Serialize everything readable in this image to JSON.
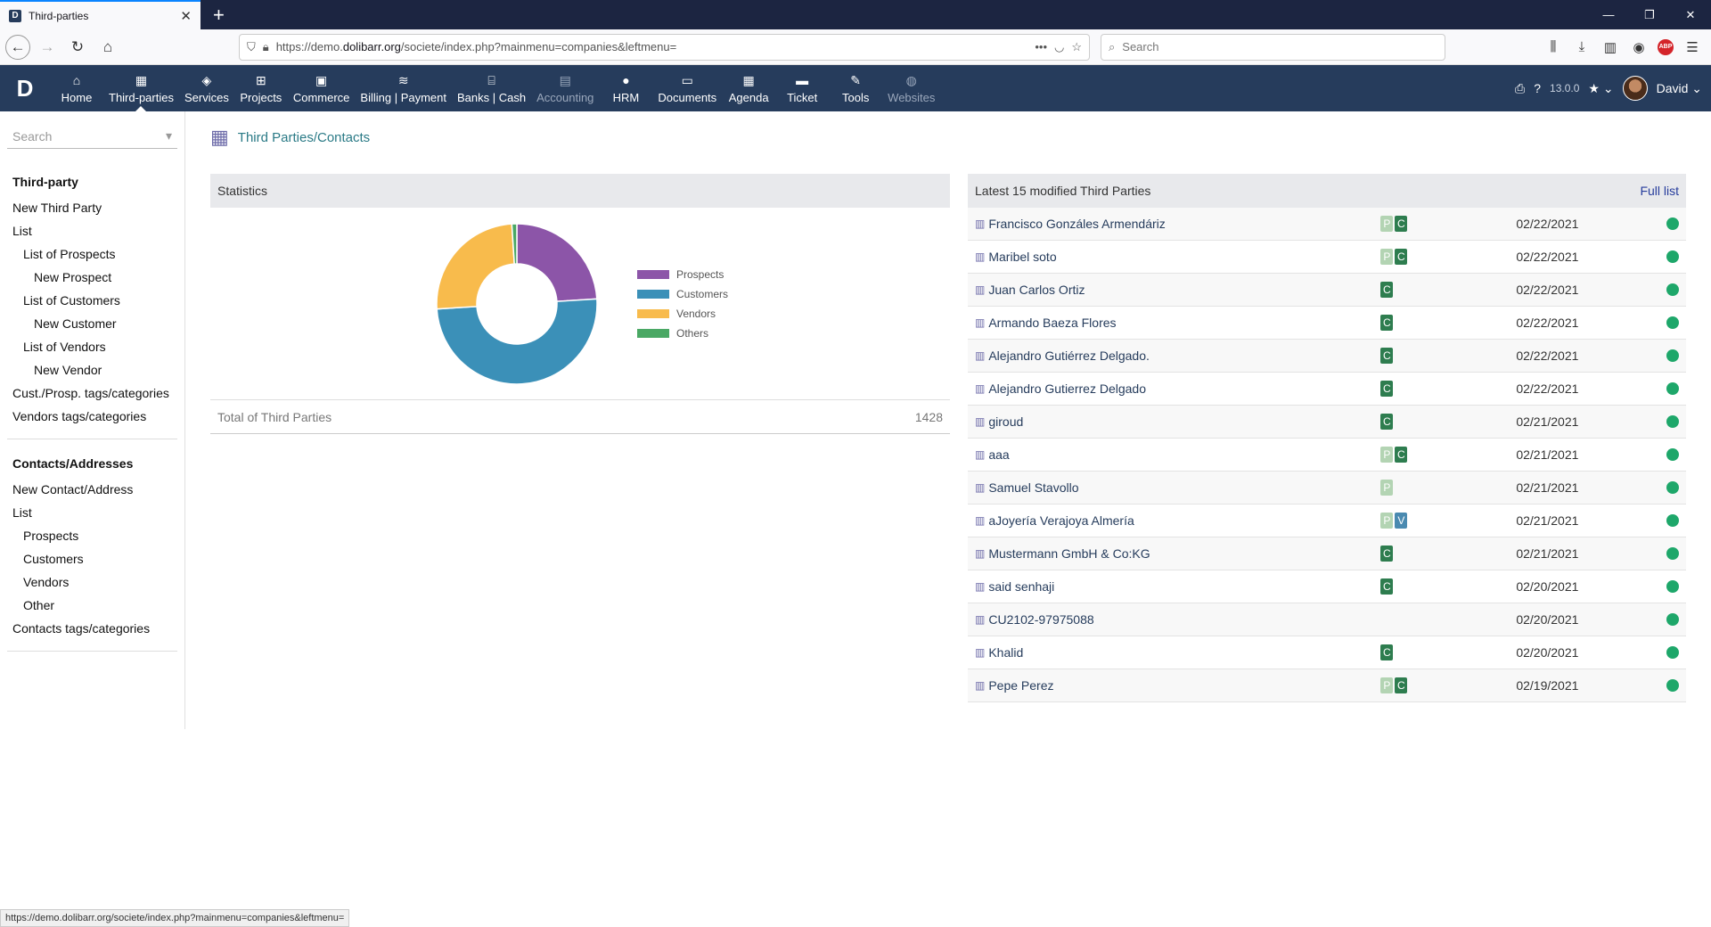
{
  "browser": {
    "tab_title": "Third-parties",
    "url_prefix": "https://demo.",
    "url_domain": "dolibarr.org",
    "url_rest": "/societe/index.php?mainmenu=companies&leftmenu=",
    "search_placeholder": "Search",
    "status_url": "https://demo.dolibarr.org/societe/index.php?mainmenu=companies&leftmenu="
  },
  "topmenu": {
    "items": [
      {
        "label": "Home",
        "icon": "⌂"
      },
      {
        "label": "Third-parties",
        "icon": "▦"
      },
      {
        "label": "Services",
        "icon": "◈"
      },
      {
        "label": "Projects",
        "icon": "⊞"
      },
      {
        "label": "Commerce",
        "icon": "▣"
      },
      {
        "label": "Billing | Payment",
        "icon": "≋"
      },
      {
        "label": "Banks | Cash",
        "icon": "⌸"
      },
      {
        "label": "Accounting",
        "icon": "▤"
      },
      {
        "label": "HRM",
        "icon": "●"
      },
      {
        "label": "Documents",
        "icon": "▭"
      },
      {
        "label": "Agenda",
        "icon": "▦"
      },
      {
        "label": "Ticket",
        "icon": "▬"
      },
      {
        "label": "Tools",
        "icon": "✎"
      },
      {
        "label": "Websites",
        "icon": "◍"
      }
    ],
    "version": "13.0.0",
    "user": "David"
  },
  "sidebar": {
    "search_placeholder": "Search",
    "thirdparty_header": "Third-party",
    "new_third_party": "New Third Party",
    "list": "List",
    "list_prospects": "List of Prospects",
    "new_prospect": "New Prospect",
    "list_customers": "List of Customers",
    "new_customer": "New Customer",
    "list_vendors": "List of Vendors",
    "new_vendor": "New Vendor",
    "cust_tags": "Cust./Prosp. tags/categories",
    "vendor_tags": "Vendors tags/categories",
    "contacts_header": "Contacts/Addresses",
    "new_contact": "New Contact/Address",
    "contacts_list": "List",
    "prospects": "Prospects",
    "customers": "Customers",
    "vendors": "Vendors",
    "other": "Other",
    "contacts_tags": "Contacts tags/categories"
  },
  "page": {
    "title": "Third Parties/Contacts"
  },
  "stats": {
    "header": "Statistics",
    "total_label": "Total of Third Parties",
    "total_value": "1428"
  },
  "chart_data": {
    "type": "pie",
    "categories": [
      "Prospects",
      "Customers",
      "Vendors",
      "Others"
    ],
    "values": [
      24,
      50,
      25,
      1
    ],
    "colors": [
      "#8c55a8",
      "#3b90b8",
      "#f8bb4c",
      "#4aa864"
    ],
    "legend": "right"
  },
  "latest": {
    "header": "Latest 15 modified Third Parties",
    "full_list": "Full list",
    "rows": [
      {
        "name": "Francisco Gonzáles Armendáriz",
        "badges": [
          "P",
          "C"
        ],
        "date": "02/22/2021"
      },
      {
        "name": "Maribel soto",
        "badges": [
          "P",
          "C"
        ],
        "date": "02/22/2021"
      },
      {
        "name": "Juan Carlos Ortiz",
        "badges": [
          "C"
        ],
        "date": "02/22/2021"
      },
      {
        "name": "Armando Baeza Flores",
        "badges": [
          "C"
        ],
        "date": "02/22/2021"
      },
      {
        "name": "Alejandro Gutiérrez Delgado.",
        "badges": [
          "C"
        ],
        "date": "02/22/2021"
      },
      {
        "name": "Alejandro Gutierrez Delgado",
        "badges": [
          "C"
        ],
        "date": "02/22/2021"
      },
      {
        "name": "giroud",
        "badges": [
          "C"
        ],
        "date": "02/21/2021"
      },
      {
        "name": "aaa",
        "badges": [
          "P",
          "C"
        ],
        "date": "02/21/2021"
      },
      {
        "name": "Samuel Stavollo",
        "badges": [
          "P"
        ],
        "date": "02/21/2021"
      },
      {
        "name": "aJoyería Verajoya Almería",
        "badges": [
          "P",
          "V"
        ],
        "date": "02/21/2021"
      },
      {
        "name": "Mustermann GmbH & Co:KG",
        "badges": [
          "C"
        ],
        "date": "02/21/2021"
      },
      {
        "name": "said senhaji",
        "badges": [
          "C"
        ],
        "date": "02/20/2021"
      },
      {
        "name": "CU2102-97975088",
        "badges": [],
        "date": "02/20/2021"
      },
      {
        "name": "Khalid",
        "badges": [
          "C"
        ],
        "date": "02/20/2021"
      },
      {
        "name": "Pepe Perez",
        "badges": [
          "P",
          "C"
        ],
        "date": "02/19/2021"
      }
    ]
  }
}
